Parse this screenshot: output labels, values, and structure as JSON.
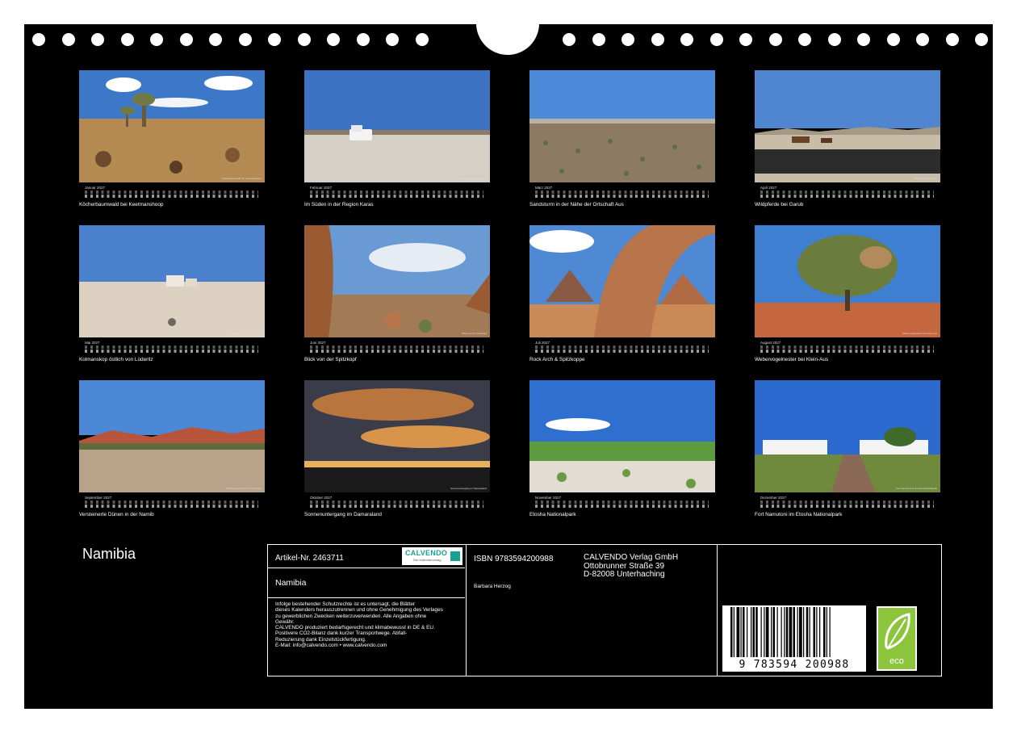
{
  "calendar": {
    "title": "Namibia",
    "months": [
      {
        "name": "Januar 2027",
        "caption": "Köcherbaumwald bei Keetmanshoop",
        "credit": "Köcherbaumwald bei Keetmanshoop"
      },
      {
        "name": "Februar 2027",
        "caption": "Im Süden in der Region Karas",
        "credit": "Im Süden in der Region Karas"
      },
      {
        "name": "März 2027",
        "caption": "Sandsturm in der Nähe der Ortschaft Aus",
        "credit": ""
      },
      {
        "name": "April 2027",
        "caption": "Wildpferde bei Garub",
        "credit": "Wildpferde bei Garub"
      },
      {
        "name": "Mai 2027",
        "caption": "Kolmanskop östlich von Lüderitz",
        "credit": "Kolmanskop östlich von Lüderitz"
      },
      {
        "name": "Juni 2027",
        "caption": "Blick von der Spitzkopf",
        "credit": "Blick von der Spitzkopf"
      },
      {
        "name": "Juli 2027",
        "caption": "Rock Arch & Spitzkoppe",
        "credit": ""
      },
      {
        "name": "August 2027",
        "caption": "Webervogelnester bei Klein-Aus",
        "credit": "Webervogelnester bei Klein-Aus"
      },
      {
        "name": "September 2027",
        "caption": "Versteinerte Dünen in der Namib",
        "credit": "Versteinerte Dünen in der Namib"
      },
      {
        "name": "Oktober 2027",
        "caption": "Sonnenuntergang im Damaraland",
        "credit": "Sonnenuntergang im Damaraland"
      },
      {
        "name": "November 2027",
        "caption": "Etosha Nationalpark",
        "credit": "Etosha Nationalpark"
      },
      {
        "name": "Dezember 2027",
        "caption": "Fort Namutoni im Etosha Nationalpark",
        "credit": "Fort Namutoni im Etosha Nationalpark"
      }
    ]
  },
  "info": {
    "article": "Artikel-Nr. 2463711",
    "logo": {
      "word": "CALVENDO",
      "sub": "Der Kalenderverlag"
    },
    "product_name": "Namibia",
    "legal_lines": [
      "Infolge bestehender Schutzrechte ist es untersagt, die Blätter",
      "dieses Kalenders herauszutrennen und ohne Genehmigung des Verlages",
      "zu gewerblichen Zwecken weiterzuverwenden. Alle Angaben ohne",
      "Gewähr.",
      "CALVENDO produziert bedarfsgerecht und klimabewusst in DE & EU.",
      "Positivere CO2-Bilanz dank kurzer Transportwege. Abfall-",
      "Reduzierung dank Einzelstückfertigung.",
      "E-Mail: info@calvendo.com • www.calvendo.com"
    ],
    "isbn": "ISBN 9783594200988",
    "publisher_lines": [
      "CALVENDO Verlag GmbH",
      "Ottobrunner Straße 39",
      "D-82008 Unterhaching"
    ],
    "author": "Barbara Herzog",
    "barcode_number": "9  783594  200988",
    "eco_label": "eco"
  },
  "colors": {
    "sheet": "#000000",
    "eco_green": "#8cc43c",
    "calvendo_teal": "#1aa094"
  }
}
